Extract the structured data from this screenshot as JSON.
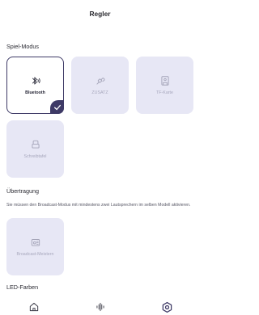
{
  "header": {
    "title": "Regler"
  },
  "game_mode": {
    "title": "Spiel-Modus",
    "cards": [
      {
        "label": "Bluetooth",
        "icon": "bluetooth-audio-icon",
        "selected": true
      },
      {
        "label": "ZUSATZ",
        "icon": "aux-cable-icon",
        "selected": false
      },
      {
        "label": "TF-Karte",
        "icon": "sd-card-icon",
        "selected": false
      },
      {
        "label": "Schreibtafel",
        "icon": "drawing-tablet-icon",
        "selected": false
      }
    ]
  },
  "broadcast": {
    "title": "Übertragung",
    "description": "Sie müssen den Broadcast-Modus mit mindestens zwei Lautsprechern im selben Modell aktivieren.",
    "cards": [
      {
        "label": "Broadcast-Meistern",
        "icon": "broadcast-master-icon",
        "selected": false
      }
    ]
  },
  "led": {
    "title": "LED-Farben"
  },
  "bottom_nav": {
    "items": [
      {
        "icon": "home-icon",
        "active": false
      },
      {
        "icon": "equalizer-icon",
        "active": false
      },
      {
        "icon": "settings-icon",
        "active": true
      }
    ]
  },
  "colors": {
    "accent": "#3e3a66",
    "card_bg": "#e7e7f5",
    "disabled_text": "#a8a8bd"
  }
}
